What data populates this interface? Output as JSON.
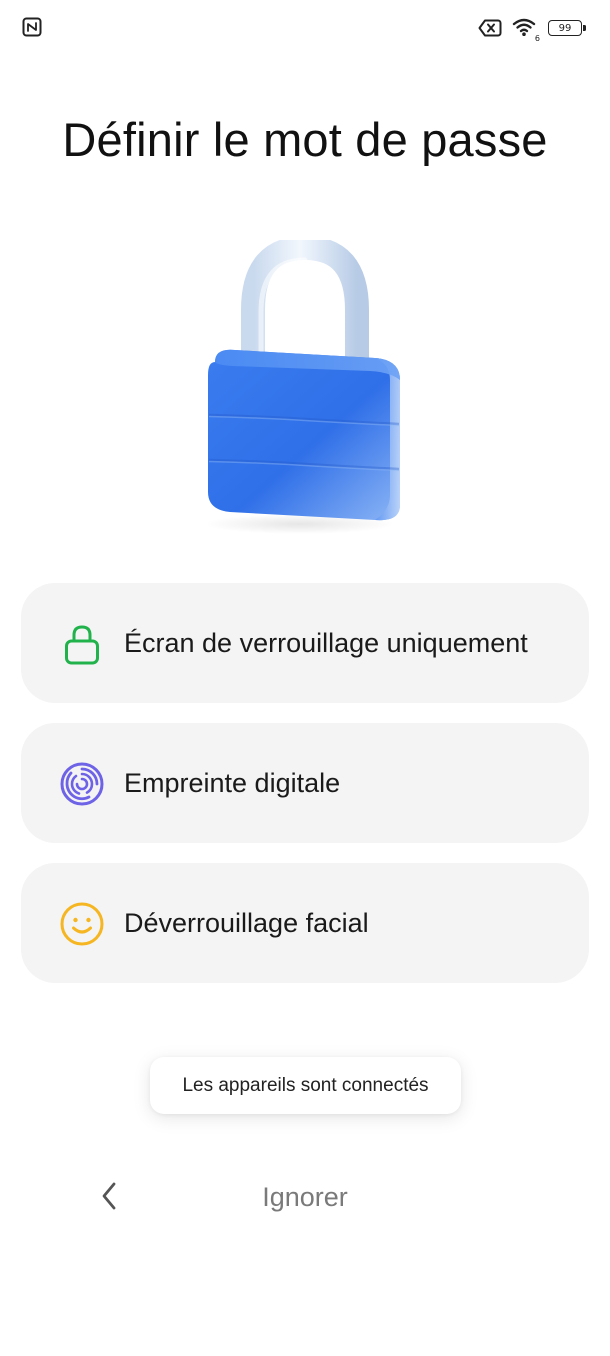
{
  "status_bar": {
    "left_icon": "nfc-icon",
    "signal_icon": "no-sim-icon",
    "wifi_icon": "wifi-icon",
    "wifi_badge": "6",
    "battery_level": "99"
  },
  "page": {
    "title": "Définir le mot de passe",
    "hero_icon": "padlock-illustration"
  },
  "options": [
    {
      "label": "Écran de verrouillage uniquement",
      "icon": "lock-icon",
      "icon_color": "#22b24c"
    },
    {
      "label": "Empreinte digitale",
      "icon": "fingerprint-icon",
      "icon_color": "#6e63e6"
    },
    {
      "label": "Déverrouillage facial",
      "icon": "face-smile-icon",
      "icon_color": "#f5b621"
    }
  ],
  "toast": {
    "message": "Les appareils sont connectés"
  },
  "bottom_nav": {
    "back_icon": "chevron-left-icon",
    "skip_label": "Ignorer"
  }
}
